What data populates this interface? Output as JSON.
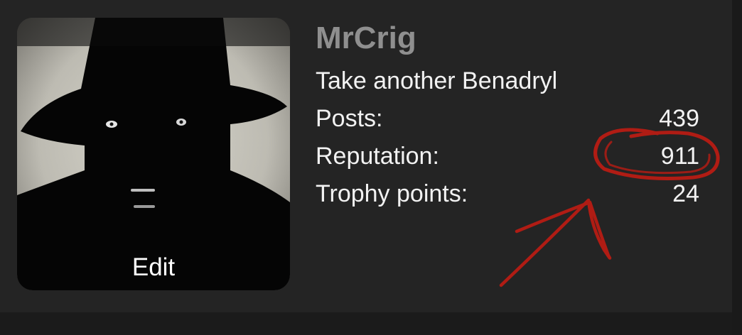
{
  "profile": {
    "username": "MrCrig",
    "user_title": "Take another Benadryl",
    "avatar_edit_label": "Edit",
    "stats": [
      {
        "label": "Posts:",
        "value": "439"
      },
      {
        "label": "Reputation:",
        "value": "911"
      },
      {
        "label": "Trophy points:",
        "value": "24"
      }
    ]
  },
  "colors": {
    "card_background": "#242424",
    "page_background": "#1b1b1b",
    "username": "#8f8f8f",
    "text": "#f2f2f2",
    "annotation": "#b01c14"
  }
}
